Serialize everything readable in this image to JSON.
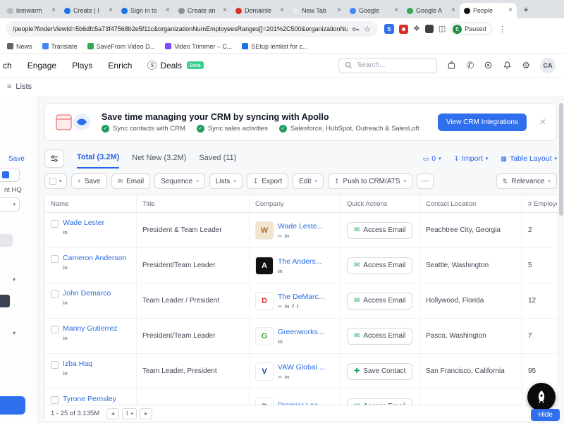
{
  "browser": {
    "tabs": [
      {
        "label": "lemwarm",
        "fav": "#b8bcc2"
      },
      {
        "label": "Create | l",
        "fav": "#1a73e8"
      },
      {
        "label": "Sign in to",
        "fav": "#1a73e8"
      },
      {
        "label": "Create an",
        "fav": "#8a8f98"
      },
      {
        "label": "Domainle",
        "fav": "#d93025"
      },
      {
        "label": "New Tab",
        "fav": "#e8eaed"
      },
      {
        "label": "Google",
        "fav": "#4285f4"
      },
      {
        "label": "Google A",
        "fav": "#34a853"
      },
      {
        "label": "People",
        "fav": "#111111",
        "active": true
      }
    ],
    "newtab_button": "+",
    "url": "/people?finderViewId=5b6dfc5a73f47568b2e5f11c&organizationNumEmployeesRanges[]=201%2C500&organizationNu...",
    "star": "☆",
    "extensions": {
      "s": "S",
      "paused_initial": "E",
      "paused": "Paused",
      "menu": "⋮"
    },
    "bookmarks": [
      {
        "label": "News",
        "fav": "#5f6368"
      },
      {
        "label": "Translate",
        "fav": "#4285f4"
      },
      {
        "label": "SaveFrom Video D...",
        "fav": "#34a853"
      },
      {
        "label": "Video Trimmer – C...",
        "fav": "#7c4dff"
      },
      {
        "label": "SEtup lemlist for c...",
        "fav": "#1a73e8"
      }
    ]
  },
  "nav": {
    "search_frag": "ch",
    "engage": "Engage",
    "plays": "Plays",
    "enrich": "Enrich",
    "deals": "Deals",
    "deals_badge": "Beta",
    "search_placeholder": "Search...",
    "avatar": "CA"
  },
  "lists": {
    "label": "Lists"
  },
  "banner": {
    "title": "Save time managing your CRM by syncing with Apollo",
    "features": [
      {
        "text": "Sync contacts with CRM"
      },
      {
        "text": "Sync sales activities"
      },
      {
        "text": "Salesforce, HubSpot, Outreach & SalesLoft"
      }
    ],
    "cta": "View CRM Integrations"
  },
  "results": {
    "tab_total": "Total (3.2M)",
    "tab_net_new": "Net New (3.2M)",
    "tab_saved": "Saved (11)",
    "credits": "0",
    "import": "Import",
    "layout": "Table Layout"
  },
  "toolbar": {
    "save": "Save",
    "email": "Email",
    "sequence": "Sequence",
    "lists": "Lists",
    "export": "Export",
    "edit": "Edit",
    "push": "Push to CRM/ATS",
    "more": "⋯",
    "sort": "Relevance"
  },
  "table": {
    "columns": [
      "Name",
      "Title",
      "Company",
      "Quick Actions",
      "Contact Location",
      "# Employe"
    ],
    "rows": [
      {
        "name": "Wade Lester",
        "title": "President & Team Leader",
        "company": "Wade Leste...",
        "logo_bg": "#f2e4cc",
        "logo_fg": "#a4713a",
        "logo_letter": "W",
        "name_socials": [
          "linkedin"
        ],
        "company_socials": [
          "link",
          "linkedin"
        ],
        "action": "Access Email",
        "action_icon": "email",
        "location": "Peachtree City, Georgia",
        "employees": "2"
      },
      {
        "name": "Cameron Anderson",
        "title": "President/Team Leader",
        "company": "The Anders...",
        "logo_bg": "#111111",
        "logo_fg": "#ffffff",
        "logo_letter": "A",
        "name_socials": [
          "linkedin"
        ],
        "company_socials": [
          "linkedin"
        ],
        "action": "Access Email",
        "action_icon": "email",
        "location": "Seattle, Washington",
        "employees": "5"
      },
      {
        "name": "John Demarco",
        "title": "Team Leader / President",
        "company": "The DeMarc...",
        "logo_bg": "#ffffff",
        "logo_fg": "#d32f2f",
        "logo_letter": "D",
        "name_socials": [
          "linkedin"
        ],
        "company_socials": [
          "link",
          "linkedin",
          "facebook",
          "twitter"
        ],
        "action": "Access Email",
        "action_icon": "email",
        "location": "Hollywood, Florida",
        "employees": "12"
      },
      {
        "name": "Manny Gutierrez",
        "title": "President/Team Leader",
        "company": "Greenworks...",
        "logo_bg": "#ffffff",
        "logo_fg": "#3f9d3a",
        "logo_letter": "G",
        "name_socials": [
          "linkedin"
        ],
        "company_socials": [
          "linkedin"
        ],
        "action": "Access Email",
        "action_icon": "email",
        "location": "Pasco, Washington",
        "employees": "7"
      },
      {
        "name": "Izba Haq",
        "title": "Team Leader, President",
        "company": "VAW Global ...",
        "logo_bg": "#ffffff",
        "logo_fg": "#20409a",
        "logo_letter": "V",
        "name_socials": [
          "linkedin"
        ],
        "company_socials": [
          "link",
          "linkedin"
        ],
        "action": "Save Contact",
        "action_icon": "save",
        "location": "San Francisco, California",
        "employees": "95"
      },
      {
        "name": "Tyrone Pernsley",
        "title": "",
        "company": "Premier Lea...",
        "logo_bg": "#ffffff",
        "logo_fg": "#6b7280",
        "logo_letter": "P",
        "name_socials": [],
        "company_socials": [],
        "action": "Access Email",
        "action_icon": "email",
        "location": "",
        "employees": ""
      }
    ]
  },
  "pager": {
    "range": "1 - 25 of 3.135M",
    "page": "1"
  },
  "left_panel": {
    "save": "Save",
    "hq_fragment": "nt HQ"
  },
  "fab": {
    "hide": "Hide"
  }
}
